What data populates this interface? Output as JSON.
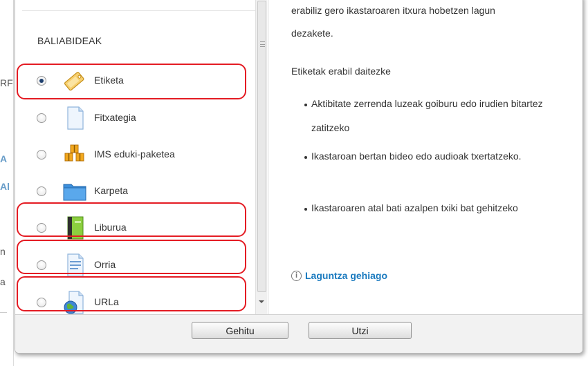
{
  "background": {
    "fragments": [
      "RF",
      "A",
      "Al",
      "n",
      "a"
    ]
  },
  "resources": {
    "section_label": "BALIABIDEAK",
    "items": [
      {
        "label": "Etiketa",
        "icon": "label-tag-icon",
        "checked": true,
        "highlighted": true
      },
      {
        "label": "Fitxategia",
        "icon": "file-icon",
        "checked": false,
        "highlighted": false
      },
      {
        "label": "IMS eduki-paketea",
        "icon": "ims-package-icon",
        "checked": false,
        "highlighted": false
      },
      {
        "label": "Karpeta",
        "icon": "folder-icon",
        "checked": false,
        "highlighted": false
      },
      {
        "label": "Liburua",
        "icon": "book-icon",
        "checked": false,
        "highlighted": true
      },
      {
        "label": "Orria",
        "icon": "page-icon",
        "checked": false,
        "highlighted": true
      },
      {
        "label": "URLa",
        "icon": "url-globe-icon",
        "checked": false,
        "highlighted": true
      }
    ]
  },
  "description": {
    "intro_tail_1": "erabiliz gero ikastaroaren itxura hobetzen lagun",
    "intro_tail_2": "dezakete.",
    "uses_heading": "Etiketak erabil daitezke",
    "bullets": [
      "Aktibitate zerrenda luzeak goiburu edo irudien bitartez zatitzeko",
      "Ikastaroan bertan bideo edo audioak txertatzeko.",
      "Ikastaroaren atal bati azalpen txiki bat gehitzeko"
    ],
    "more_help": "Laguntza gehiago"
  },
  "footer": {
    "add_label": "Gehitu",
    "cancel_label": "Utzi"
  },
  "colors": {
    "highlight": "#e41b23",
    "link": "#1a7abf"
  }
}
